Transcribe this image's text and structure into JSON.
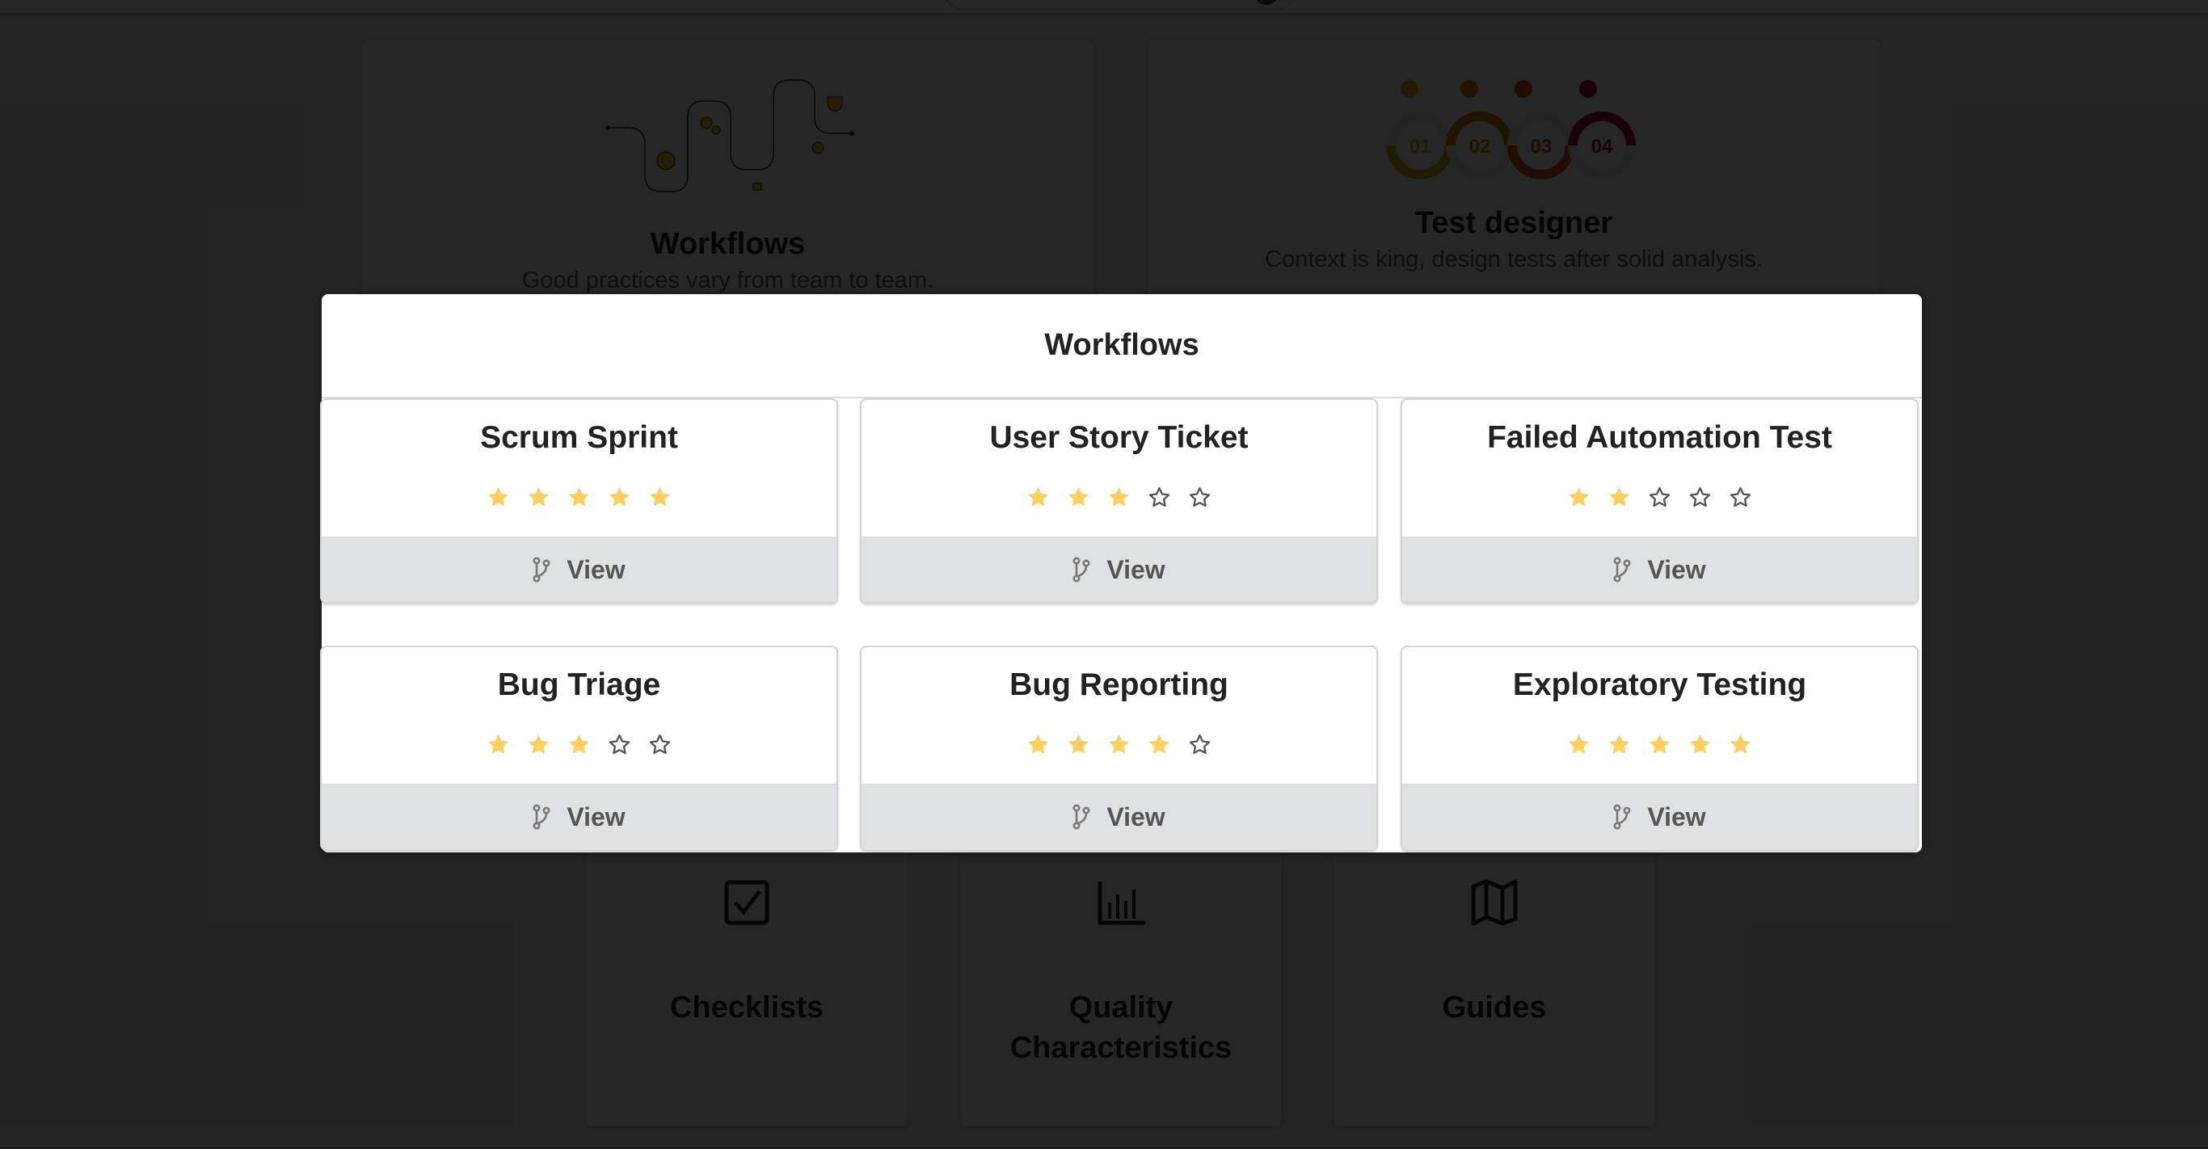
{
  "background": {
    "feature_cards": [
      {
        "title": "Workflows",
        "subtitle": "Good practices vary from team to team.",
        "illustration": "winding-path-illustration"
      },
      {
        "title": "Test designer",
        "subtitle": "Context is king, design tests after solid analysis.",
        "illustration": "numbered-rings-illustration",
        "ring_labels": [
          "01",
          "02",
          "03",
          "04"
        ]
      }
    ],
    "tool_cards": [
      {
        "title": "Checklists",
        "icon": "checkbox-icon"
      },
      {
        "title": "Quality Characteristics",
        "icon": "bar-chart-icon"
      },
      {
        "title": "Guides",
        "icon": "map-icon"
      }
    ]
  },
  "modal": {
    "title": "Workflows",
    "star_max": 5,
    "star_color": "#FDCF5E",
    "view_label": "View",
    "view_icon": "branch-icon",
    "workflows": [
      {
        "title": "Scrum Sprint",
        "rating": 5
      },
      {
        "title": "User Story Ticket",
        "rating": 3
      },
      {
        "title": "Failed Automation Test",
        "rating": 2
      },
      {
        "title": "Bug Triage",
        "rating": 3
      },
      {
        "title": "Bug Reporting",
        "rating": 4
      },
      {
        "title": "Exploratory Testing",
        "rating": 5
      }
    ]
  }
}
